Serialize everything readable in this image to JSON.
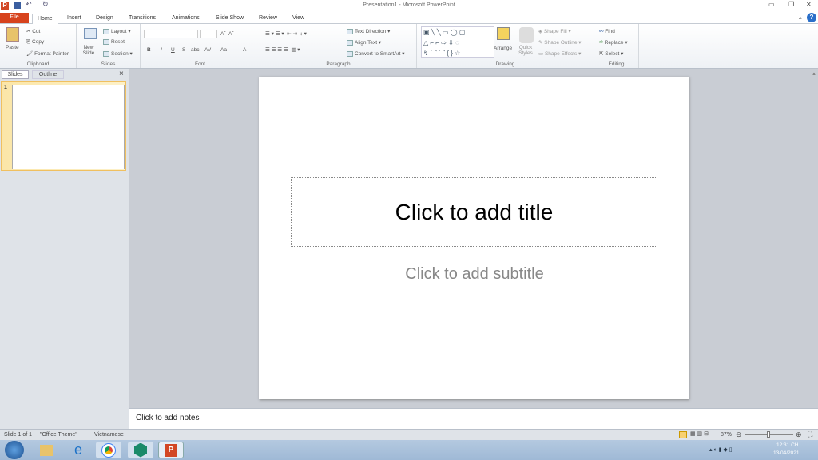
{
  "window": {
    "title": "Presentation1 - Microsoft PowerPoint",
    "app_icon": "P"
  },
  "tabs": [
    "File",
    "Home",
    "Insert",
    "Design",
    "Transitions",
    "Animations",
    "Slide Show",
    "Review",
    "View"
  ],
  "ribbon": {
    "clipboard": {
      "label": "Clipboard",
      "paste": "Paste",
      "cut": "Cut",
      "copy": "Copy",
      "format_painter": "Format Painter"
    },
    "slides": {
      "label": "Slides",
      "new_slide": "New Slide",
      "layout": "Layout",
      "reset": "Reset",
      "section": "Section"
    },
    "font": {
      "label": "Font",
      "bold": "B",
      "italic": "I",
      "underline": "U",
      "shadow": "S",
      "strike": "abc",
      "spacing": "AV",
      "case": "Aa",
      "color": "A",
      "grow": "Aˆ",
      "shrink": "Aˇ"
    },
    "paragraph": {
      "label": "Paragraph",
      "text_direction": "Text Direction",
      "align_text": "Align Text",
      "smartart": "Convert to SmartArt"
    },
    "drawing": {
      "label": "Drawing",
      "arrange": "Arrange",
      "quick_styles": "Quick Styles",
      "shape_fill": "Shape Fill",
      "shape_outline": "Shape Outline",
      "shape_effects": "Shape Effects"
    },
    "editing": {
      "label": "Editing",
      "find": "Find",
      "replace": "Replace",
      "select": "Select"
    }
  },
  "left_panel": {
    "tabs": [
      "Slides",
      "Outline"
    ],
    "close": "×",
    "thumb_number": "1"
  },
  "slide": {
    "title_placeholder": "Click to add title",
    "subtitle_placeholder": "Click to add subtitle"
  },
  "notes": {
    "placeholder": "Click to add notes"
  },
  "status": {
    "slide": "Slide 1 of 1",
    "theme": "\"Office Theme\"",
    "language": "Vietnamese",
    "zoom": "87%",
    "zoom_level": 87
  },
  "taskbar": {
    "time": "12:31 CH",
    "date": "13/04/2021"
  }
}
